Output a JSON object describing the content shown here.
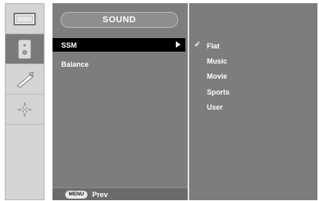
{
  "sidebar": {
    "tabs": [
      {
        "name": "picture-tab",
        "icon": "monitor-icon"
      },
      {
        "name": "sound-tab",
        "icon": "speaker-icon",
        "active": true
      },
      {
        "name": "time-tab",
        "icon": "tool-icon"
      },
      {
        "name": "option-tab",
        "icon": "settings-icon"
      }
    ]
  },
  "menu": {
    "title": "SOUND",
    "items": [
      {
        "label": "SSM",
        "selected": true
      },
      {
        "label": "Balance"
      }
    ]
  },
  "options": {
    "items": [
      "Flat",
      "Music",
      "Movie",
      "Sports",
      "User"
    ],
    "checked": "Flat",
    "check_glyph": "✓"
  },
  "footer": {
    "menu_key": "MENU",
    "prev_label": "Prev"
  }
}
